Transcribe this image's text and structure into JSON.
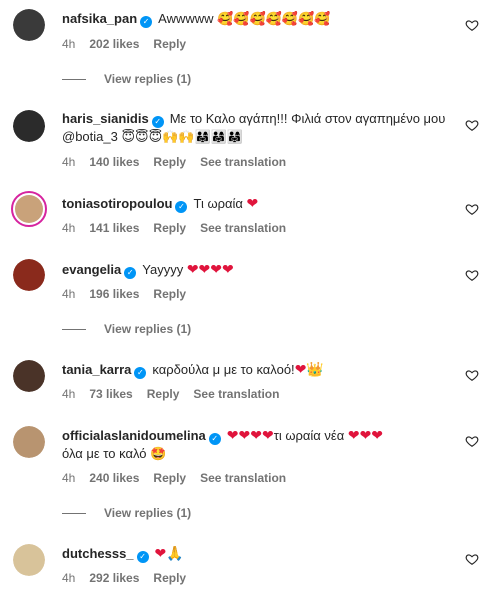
{
  "comments": [
    {
      "username": "nafsika_pan",
      "text": "Awwwww",
      "emoji": "🥰🥰🥰🥰🥰🥰🥰",
      "time": "4h",
      "likes": "202 likes",
      "reply": "Reply",
      "translate": "",
      "view_replies": "View replies (1)",
      "avatar_color": "#3a3a3a"
    },
    {
      "username": "haris_sianidis",
      "text": "Με το Καλο αγάπη!!! Φιλιά στον αγαπημένο μου @botia_3",
      "emoji": "😇😇😇🙌🙌👨‍👩‍👧👨‍👩‍👧👨‍👩‍👧",
      "time": "4h",
      "likes": "140 likes",
      "reply": "Reply",
      "translate": "See translation",
      "view_replies": "",
      "avatar_color": "#2b2b2b"
    },
    {
      "username": "toniasotiropoulou",
      "text": "Τι ωραία",
      "emoji": "❤",
      "time": "4h",
      "likes": "141 likes",
      "reply": "Reply",
      "translate": "See translation",
      "view_replies": "",
      "avatar_color": "#c9a27a"
    },
    {
      "username": "evangelia",
      "text": "Yayyyy",
      "emoji": "❤❤❤❤",
      "time": "4h",
      "likes": "196 likes",
      "reply": "Reply",
      "translate": "",
      "view_replies": "View replies (1)",
      "avatar_color": "#8a2a1c"
    },
    {
      "username": "tania_karra",
      "text": "καρδούλα μ με το καλοό!",
      "emoji": "❤👑",
      "time": "4h",
      "likes": "73 likes",
      "reply": "Reply",
      "translate": "See translation",
      "view_replies": "",
      "avatar_color": "#4a3328"
    },
    {
      "username": "officialaslanidoumelina",
      "text": "τι ωραία νέα",
      "emoji_before": "❤❤❤❤",
      "emoji": "❤❤❤",
      "text2": "όλα με το καλό",
      "emoji2": "🤩",
      "time": "4h",
      "likes": "240 likes",
      "reply": "Reply",
      "translate": "See translation",
      "view_replies": "View replies (1)",
      "avatar_color": "#b89470"
    },
    {
      "username": "dutchesss_",
      "text": "",
      "emoji": "❤🙏",
      "time": "4h",
      "likes": "292 likes",
      "reply": "Reply",
      "translate": "",
      "view_replies": "",
      "avatar_color": "#d8c39a"
    }
  ],
  "icons": {
    "verified": "verified-badge-icon",
    "like": "heart-outline-icon"
  }
}
